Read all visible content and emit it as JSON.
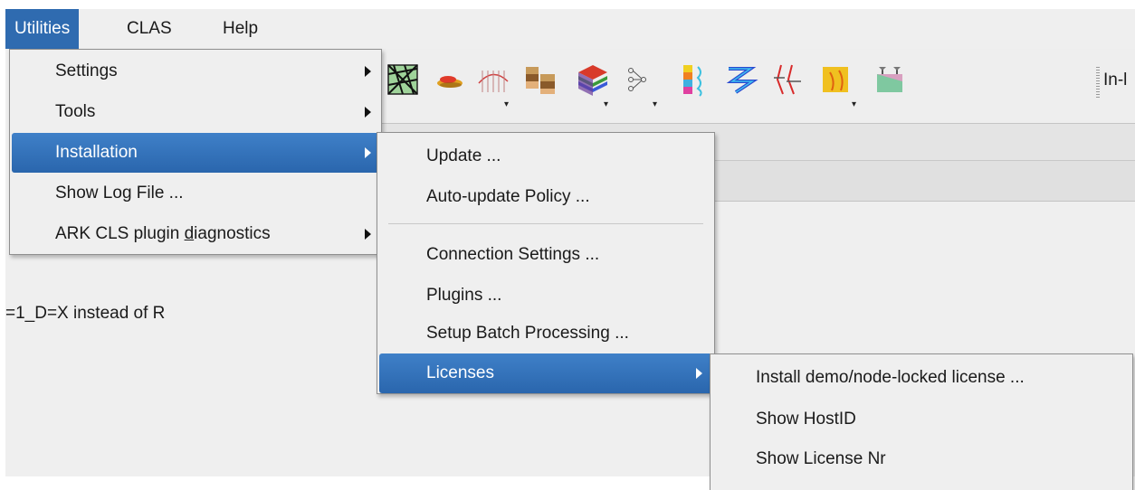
{
  "menubar": {
    "items": [
      "Utilities",
      "CLAS",
      "Help"
    ]
  },
  "toolbar": {
    "icons": [
      "seismic-grid-icon",
      "horizon-surface-icon",
      "well-trajectory-icon",
      "layer-blocks-icon",
      "colored-layers-icon",
      "network-node-icon",
      "color-bar-icon",
      "well-log-icon",
      "fault-icon",
      "map-view-icon",
      "cross-section-icon"
    ],
    "trailing_text": "In-l"
  },
  "content": {
    "text": "=1_D=X instead of R"
  },
  "utilities_menu": {
    "items": [
      {
        "label": "Settings",
        "submenu": true
      },
      {
        "label": "Tools",
        "submenu": true
      },
      {
        "label": "Installation",
        "submenu": true,
        "highlighted": true
      },
      {
        "label": "Show Log File ...",
        "submenu": false
      },
      {
        "label_before": "ARK CLS plugin ",
        "label_mnemonic": "d",
        "label_after": "iagnostics",
        "submenu": true
      }
    ]
  },
  "installation_menu": {
    "items": [
      {
        "label": "Update ..."
      },
      {
        "label": "Auto-update Policy ..."
      },
      {
        "label": "Connection Settings ..."
      },
      {
        "label": "Plugins ..."
      },
      {
        "label": "Setup Batch Processing ..."
      },
      {
        "label": "Licenses",
        "submenu": true,
        "highlighted": true
      }
    ]
  },
  "licenses_menu": {
    "items": [
      {
        "label": "Install demo/node-locked license ..."
      },
      {
        "label": "Show HostID"
      },
      {
        "label": "Show License Nr"
      }
    ]
  },
  "colors": {
    "highlight": "#2f6bb0",
    "menu_bg": "#efefef"
  }
}
